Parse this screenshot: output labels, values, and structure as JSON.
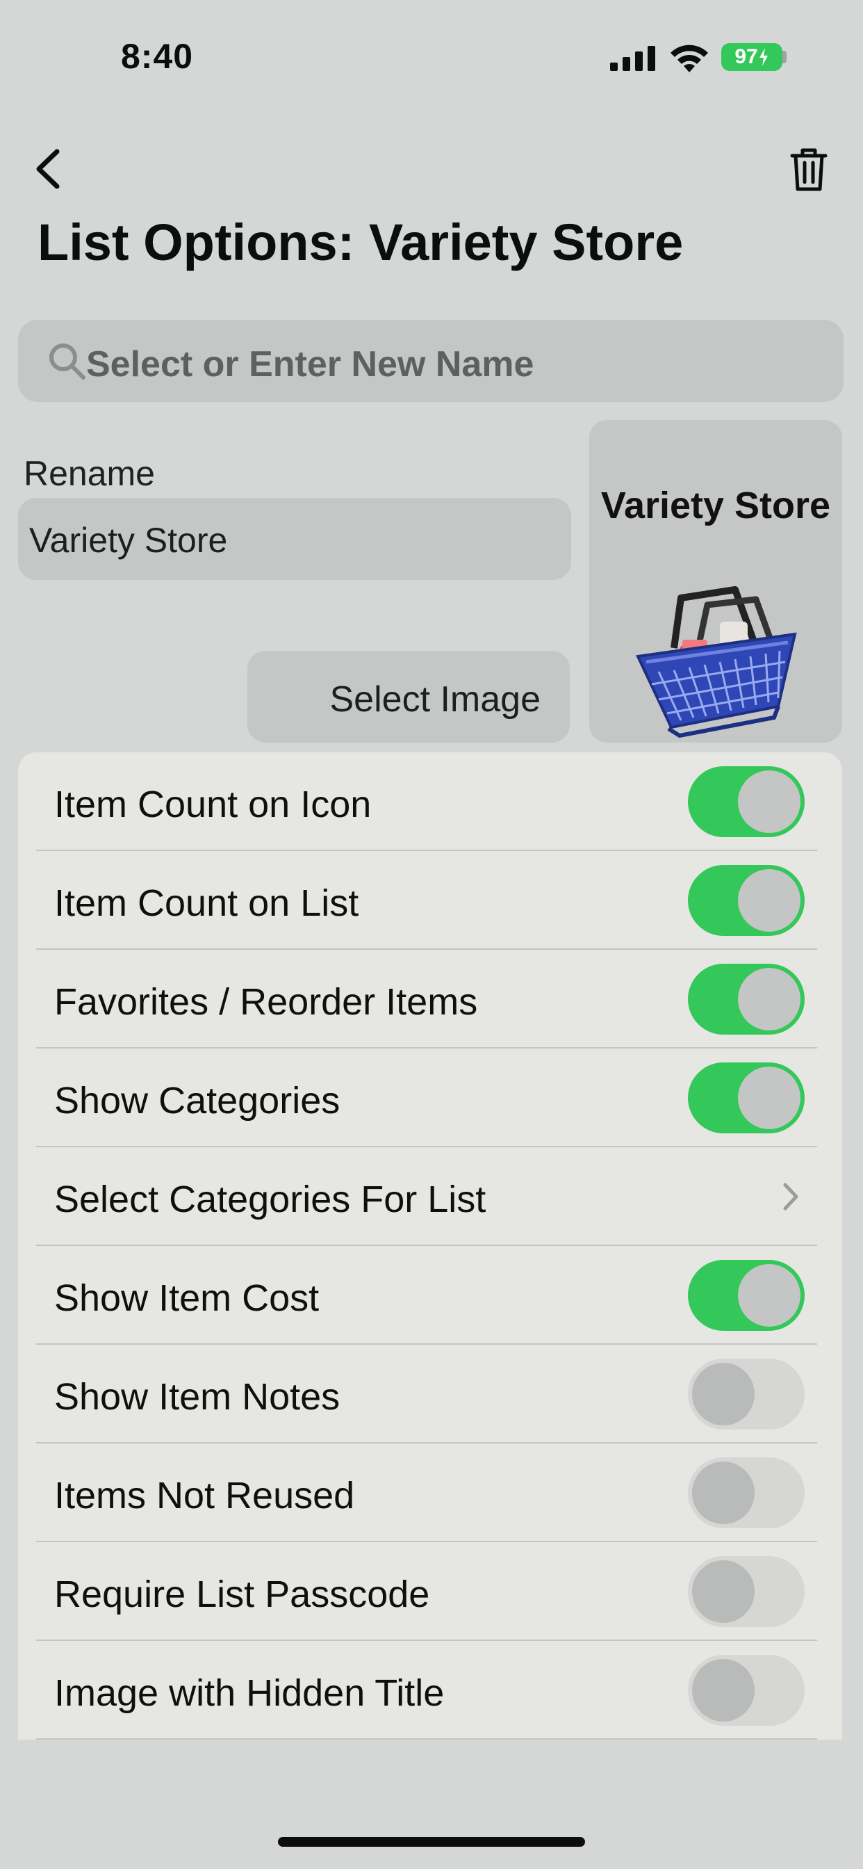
{
  "status_bar": {
    "time": "8:40",
    "battery": "97"
  },
  "nav": {
    "back_icon": "chevron-left-icon",
    "delete_icon": "trash-icon",
    "title": "List Options: Variety Store"
  },
  "search": {
    "placeholder": "Select or Enter New Name"
  },
  "rename": {
    "label": "Rename",
    "value": "Variety Store"
  },
  "select_image": {
    "label": "Select Image"
  },
  "preview": {
    "title": "Variety Store",
    "image": "shopping-basket-icon"
  },
  "settings": [
    {
      "label": "Item Count on Icon",
      "type": "toggle",
      "on": true
    },
    {
      "label": "Item Count on List",
      "type": "toggle",
      "on": true
    },
    {
      "label": "Favorites / Reorder Items",
      "type": "toggle",
      "on": true
    },
    {
      "label": "Show Categories",
      "type": "toggle",
      "on": true
    },
    {
      "label": "Select Categories For List",
      "type": "link"
    },
    {
      "label": "Show Item Cost",
      "type": "toggle",
      "on": true
    },
    {
      "label": "Show Item Notes",
      "type": "toggle",
      "on": false
    },
    {
      "label": "Items Not Reused",
      "type": "toggle",
      "on": false
    },
    {
      "label": "Require List Passcode",
      "type": "toggle",
      "on": false
    },
    {
      "label": "Image with Hidden Title",
      "type": "toggle",
      "on": false
    }
  ],
  "colors": {
    "background": "#d4d7d6",
    "toggle_on": "#34c759",
    "toggle_off": "#d6d7d5",
    "card": "#e6e7e3",
    "field": "#c4c7c6"
  }
}
